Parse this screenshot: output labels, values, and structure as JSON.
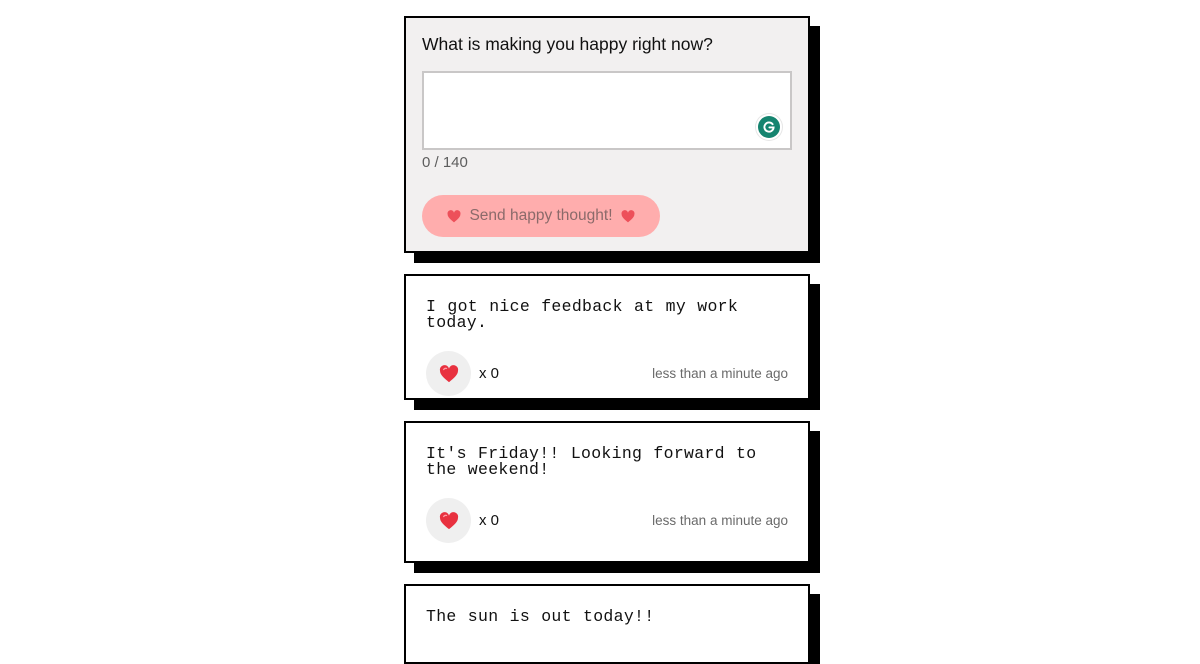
{
  "form": {
    "question": "What is making you happy right now?",
    "textarea_value": "",
    "counter": "0 / 140",
    "send_label": "Send happy thought!",
    "send_button_color": "#ffadad",
    "grammarly_icon": "grammarly-icon"
  },
  "thoughts": [
    {
      "message": "I got nice feedback at my work today.",
      "likes": "x 0",
      "time": "less than a minute ago"
    },
    {
      "message": "It's Friday!! Looking forward to the weekend!",
      "likes": "x 0",
      "time": "less than a minute ago"
    },
    {
      "message": "The sun is out today!!"
    }
  ],
  "colors": {
    "card_shadow": "#000000",
    "form_background": "#f2f0f0",
    "like_button_background": "#efefef",
    "heart": "#e8313f"
  },
  "icons": {
    "like": "heart-icon",
    "send_decoration": "heart-icon"
  }
}
